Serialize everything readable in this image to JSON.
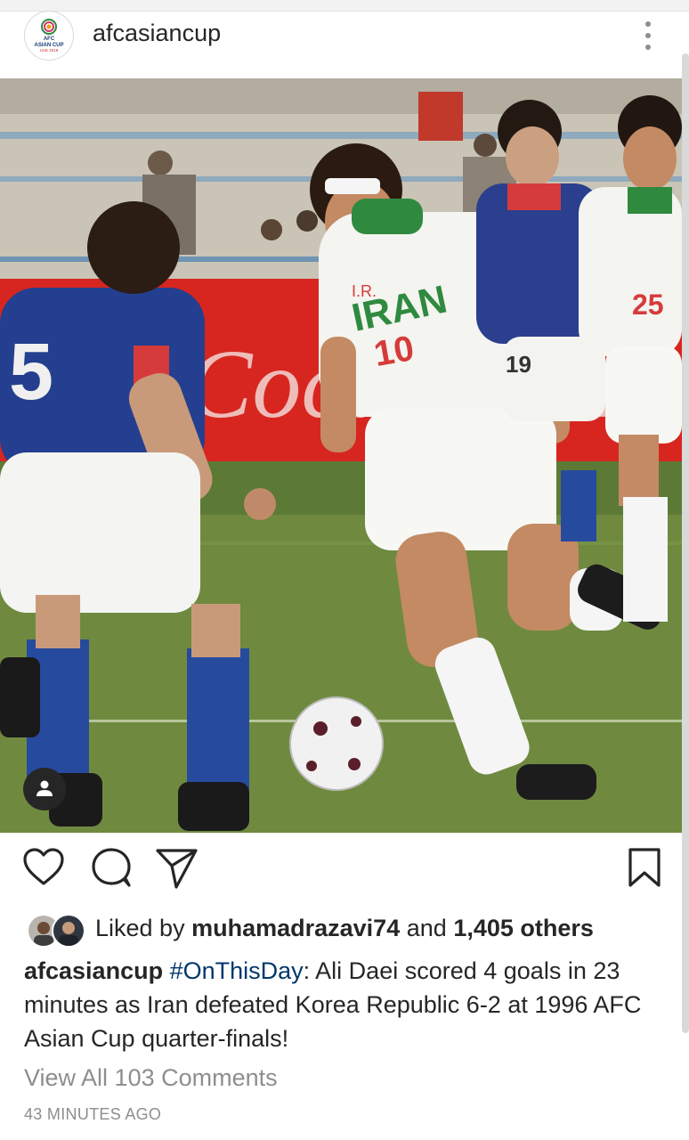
{
  "post": {
    "username": "afcasiancup",
    "logo_text": [
      "AFC",
      "ASIAN CUP",
      "UAE 2019"
    ],
    "photo_jersey_texts": [
      "IRAN",
      "10",
      "25",
      "19",
      "I.R."
    ],
    "photo_ad_text": "Coca-Cola"
  },
  "likes": {
    "prefix": "Liked by",
    "user": "muhamadrazavi74",
    "middle": "and",
    "count": "1,405 others"
  },
  "caption": {
    "username": "afcasiancup",
    "hashtag": "#OnThisDay",
    "text": ": Ali Daei scored 4 goals in 23 minutes as Iran defeated Korea Republic 6-2 at 1996 AFC Asian Cup quarter-finals!"
  },
  "comments": {
    "view_all": "View All 103 Comments"
  },
  "time_ago": "43 MINUTES AGO",
  "icons": {
    "more": "more-vertical-icon",
    "like": "heart-icon",
    "comment": "comment-icon",
    "share": "send-icon",
    "save": "bookmark-icon",
    "tag": "person-icon"
  },
  "colors": {
    "text": "#262626",
    "muted": "#8e8e8e",
    "hashtag": "#00376b"
  }
}
